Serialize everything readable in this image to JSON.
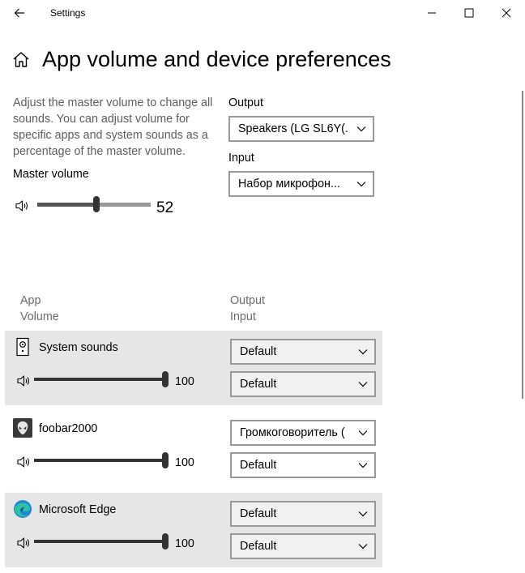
{
  "window": {
    "title": "Settings",
    "buttons": [
      "back",
      "minimize",
      "maximize",
      "close"
    ]
  },
  "page": {
    "title": "App volume and device preferences"
  },
  "master": {
    "description": "Adjust the master volume to change all sounds. You can adjust volume for specific apps and system sounds as a percentage of the master volume.",
    "label": "Master volume",
    "value": "52",
    "level": 0.52
  },
  "output": {
    "label": "Output",
    "selected": "Speakers (LG SL6Y(..."
  },
  "input": {
    "label": "Input",
    "selected": "Набор микрофон..."
  },
  "apps_header": {
    "app": "App",
    "volume": "Volume",
    "output": "Output",
    "input": "Input"
  },
  "apps": [
    {
      "name": "System sounds",
      "icon": "system-sounds-icon",
      "volume": "100",
      "level": 1.0,
      "output": "Default",
      "input": "Default"
    },
    {
      "name": "foobar2000",
      "icon": "foobar2000-icon",
      "volume": "100",
      "level": 1.0,
      "output": "Громкоговоритель (",
      "input": "Default"
    },
    {
      "name": "Microsoft Edge",
      "icon": "microsoft-edge-icon",
      "volume": "100",
      "level": 1.0,
      "output": "Default",
      "input": "Default"
    }
  ],
  "colors": {
    "shaded_row": "#e6e6e6",
    "dropdown_border": "#999999"
  }
}
